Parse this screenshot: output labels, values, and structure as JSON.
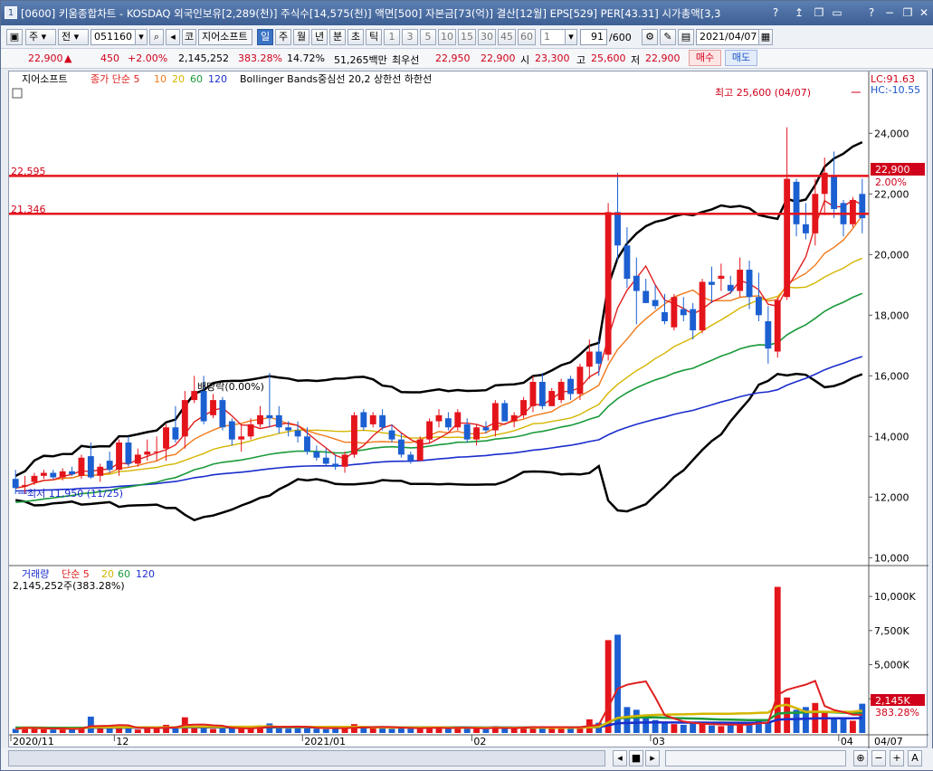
{
  "window": {
    "icon_label": "1",
    "title": "[0600] 키움종합차트 - KOSDAQ 외국인보유[2,289(천)] 주식수[14,575(천)] 액면[500] 자본금[73(억)] 결산[12월] EPS[529] PER[43.31] 시가총액[3,3",
    "controls": [
      "?",
      "↥",
      "❐",
      "▭",
      "?",
      "−",
      "❐",
      "✕"
    ]
  },
  "toolbar": {
    "period_sel": "주",
    "price_sel": "전",
    "code": "051160",
    "stock_tag": "코",
    "stock_name": "지어소프트",
    "interval_tabs": [
      "일",
      "주",
      "월",
      "년",
      "분",
      "초",
      "틱"
    ],
    "active_interval": "일",
    "numbers": [
      "1",
      "3",
      "5",
      "10",
      "15",
      "30",
      "45",
      "60"
    ],
    "count_sel": "1",
    "bar_count": "91",
    "bar_total": "/600",
    "date": "2021/04/07"
  },
  "quote": {
    "price": "22,900",
    "arrow": "▲",
    "change": "450",
    "change_pct": "+2.00%",
    "volume": "2,145,252",
    "volume_ratio": "383.28%",
    "turnover": "14.72%",
    "amount": "51,265백만",
    "best_label": "최우선",
    "best_ask": "22,950",
    "best_bid": "22,900",
    "open_label": "시",
    "open": "23,300",
    "high_label": "고",
    "high": "25,600",
    "low_label": "저",
    "low": "22,900",
    "buy_label": "매수",
    "sell_label": "매도"
  },
  "legend": {
    "stock_name": "지어소프트",
    "ma_label": "종가 단순 5",
    "ma_periods": [
      "10",
      "20",
      "60",
      "120"
    ],
    "ma_colors": [
      "#e02020",
      "#f07a1a",
      "#d4b600",
      "#1a9a3a",
      "#1a2dcc"
    ],
    "bb_label": "Bollinger Bands중심선 20,2  상한선  하한선",
    "lc": "LC:91.63",
    "hc": "HC:-10.55"
  },
  "annotations": {
    "high_text": "최고 25,600 (04/07)",
    "low_text": "최저 11,950 (11/25)",
    "dividend_text": "배당락(0.00%)",
    "line1_label": "22,595",
    "line2_label": "21,346",
    "price_tag": "22,900",
    "price_tag_pct": "2.00%"
  },
  "volume_panel": {
    "legend_label": "거래량",
    "ma_label": "단순 5",
    "ma_periods": [
      "20",
      "60",
      "120"
    ],
    "value_text": "2,145,252주(383.28%)",
    "tag": "2,145K",
    "tag_pct": "383.28%"
  },
  "chart_data": {
    "type": "candlestick",
    "title": "",
    "price_ylim": [
      9800,
      25800
    ],
    "price_ticks": [
      "24,000",
      "22,000",
      "20,000",
      "18,000",
      "16,000",
      "14,000",
      "12,000",
      "10,000"
    ],
    "volume_ylim": [
      0,
      11000
    ],
    "volume_ticks": [
      "10,000K",
      "7,500K",
      "5,000K",
      "2,500K"
    ],
    "x_labels": [
      "2020/11",
      "12",
      "2021/01",
      "02",
      "03",
      "04",
      "04/07"
    ],
    "horizontal_lines": [
      22595,
      21346
    ],
    "ohlc": [
      [
        12600,
        12900,
        12100,
        12300
      ],
      [
        12350,
        12700,
        12100,
        12400
      ],
      [
        12500,
        12800,
        12400,
        12700
      ],
      [
        12700,
        12900,
        12600,
        12800
      ],
      [
        12800,
        12900,
        12600,
        12650
      ],
      [
        12650,
        12950,
        12550,
        12850
      ],
      [
        12850,
        13000,
        12700,
        12750
      ],
      [
        12700,
        13400,
        12600,
        13300
      ],
      [
        13350,
        13800,
        12600,
        12650
      ],
      [
        12700,
        13100,
        12500,
        13000
      ],
      [
        13200,
        13500,
        12800,
        12900
      ],
      [
        12900,
        13900,
        12700,
        13800
      ],
      [
        13800,
        14000,
        13000,
        13100
      ],
      [
        13100,
        13600,
        13000,
        13400
      ],
      [
        13400,
        13900,
        13200,
        13500
      ],
      [
        13500,
        14000,
        13200,
        13500
      ],
      [
        13600,
        14400,
        13200,
        14300
      ],
      [
        14300,
        15000,
        13800,
        13900
      ],
      [
        14000,
        15500,
        13600,
        15200
      ],
      [
        15200,
        16000,
        15100,
        15500
      ],
      [
        15500,
        16000,
        14400,
        14500
      ],
      [
        14700,
        15400,
        14600,
        15200
      ],
      [
        15200,
        15300,
        14200,
        14300
      ],
      [
        14500,
        14600,
        13700,
        13900
      ],
      [
        13900,
        14400,
        13500,
        14000
      ],
      [
        14000,
        14600,
        13900,
        14400
      ],
      [
        14400,
        15000,
        14300,
        14700
      ],
      [
        14700,
        16100,
        14300,
        14600
      ],
      [
        14700,
        15000,
        14100,
        14300
      ],
      [
        14300,
        14500,
        14000,
        14200
      ],
      [
        14200,
        14500,
        13800,
        14000
      ],
      [
        14000,
        14300,
        13400,
        13500
      ],
      [
        13500,
        13700,
        13200,
        13300
      ],
      [
        13300,
        13600,
        13000,
        13100
      ],
      [
        13100,
        13400,
        12900,
        13000
      ],
      [
        13000,
        13500,
        12800,
        13400
      ],
      [
        13400,
        14800,
        13300,
        14700
      ],
      [
        14800,
        14900,
        14200,
        14300
      ],
      [
        14400,
        14800,
        14300,
        14700
      ],
      [
        14700,
        14900,
        14200,
        14300
      ],
      [
        14200,
        14400,
        13800,
        13900
      ],
      [
        13900,
        14100,
        13300,
        13400
      ],
      [
        13400,
        13500,
        13100,
        13200
      ],
      [
        13200,
        14000,
        13200,
        13900
      ],
      [
        13900,
        14600,
        13800,
        14500
      ],
      [
        14500,
        14900,
        14300,
        14700
      ],
      [
        14600,
        14800,
        14200,
        14300
      ],
      [
        14300,
        14900,
        14200,
        14800
      ],
      [
        14400,
        14600,
        13800,
        13900
      ],
      [
        13900,
        14400,
        13700,
        14300
      ],
      [
        14300,
        14500,
        14100,
        14200
      ],
      [
        14200,
        15200,
        14000,
        15100
      ],
      [
        15100,
        15200,
        14500,
        14500
      ],
      [
        14500,
        14800,
        14300,
        14700
      ],
      [
        14700,
        15300,
        14600,
        15200
      ],
      [
        15000,
        16000,
        14800,
        15800
      ],
      [
        15800,
        16100,
        14900,
        15000
      ],
      [
        15000,
        15600,
        15000,
        15500
      ],
      [
        15200,
        15900,
        15100,
        15800
      ],
      [
        15900,
        16000,
        15200,
        15400
      ],
      [
        15400,
        16400,
        15200,
        16300
      ],
      [
        16300,
        17200,
        15900,
        16800
      ],
      [
        16800,
        17200,
        16000,
        16400
      ],
      [
        16700,
        21700,
        16500,
        21400
      ],
      [
        21400,
        22700,
        19800,
        20300
      ],
      [
        20300,
        20900,
        18900,
        19200
      ],
      [
        19300,
        19900,
        17700,
        18800
      ],
      [
        18800,
        19200,
        18400,
        18400
      ],
      [
        18500,
        19000,
        18200,
        18300
      ],
      [
        18100,
        18700,
        17700,
        17800
      ],
      [
        17600,
        18700,
        17500,
        18600
      ],
      [
        18200,
        18600,
        17800,
        18000
      ],
      [
        18200,
        18400,
        17200,
        17500
      ],
      [
        17500,
        19200,
        17400,
        19100
      ],
      [
        19100,
        19600,
        18400,
        19000
      ],
      [
        19200,
        19700,
        18800,
        19300
      ],
      [
        19000,
        19300,
        18700,
        18800
      ],
      [
        18800,
        19900,
        18600,
        19500
      ],
      [
        19500,
        19800,
        18200,
        18600
      ],
      [
        18600,
        19400,
        17800,
        18000
      ],
      [
        17800,
        18300,
        16400,
        16900
      ],
      [
        16800,
        18600,
        16600,
        18500
      ],
      [
        18600,
        24200,
        18500,
        22500
      ],
      [
        22400,
        22500,
        20600,
        21000
      ],
      [
        21000,
        21700,
        20500,
        20700
      ],
      [
        20700,
        22500,
        20300,
        22000
      ],
      [
        22000,
        23200,
        21300,
        22700
      ],
      [
        22600,
        23400,
        21200,
        21500
      ],
      [
        21700,
        21800,
        20600,
        21000
      ],
      [
        21000,
        21900,
        20900,
        21800
      ],
      [
        22000,
        22500,
        20700,
        21200
      ]
    ],
    "volume": [
      300,
      450,
      350,
      280,
      260,
      330,
      280,
      420,
      1200,
      350,
      400,
      500,
      380,
      250,
      320,
      350,
      600,
      500,
      1150,
      450,
      400,
      300,
      350,
      380,
      300,
      320,
      550,
      700,
      400,
      320,
      380,
      500,
      320,
      280,
      300,
      350,
      650,
      450,
      400,
      380,
      300,
      450,
      320,
      320,
      430,
      380,
      330,
      420,
      350,
      300,
      280,
      500,
      380,
      340,
      450,
      500,
      500,
      380,
      330,
      400,
      500,
      1000,
      750,
      6800,
      7200,
      1900,
      1700,
      1300,
      950,
      700,
      650,
      600,
      800,
      650,
      550,
      500,
      600,
      700,
      700,
      1000,
      800,
      10700,
      2600,
      1700,
      1900,
      2200,
      1500,
      1100,
      1000,
      900,
      2145
    ]
  }
}
